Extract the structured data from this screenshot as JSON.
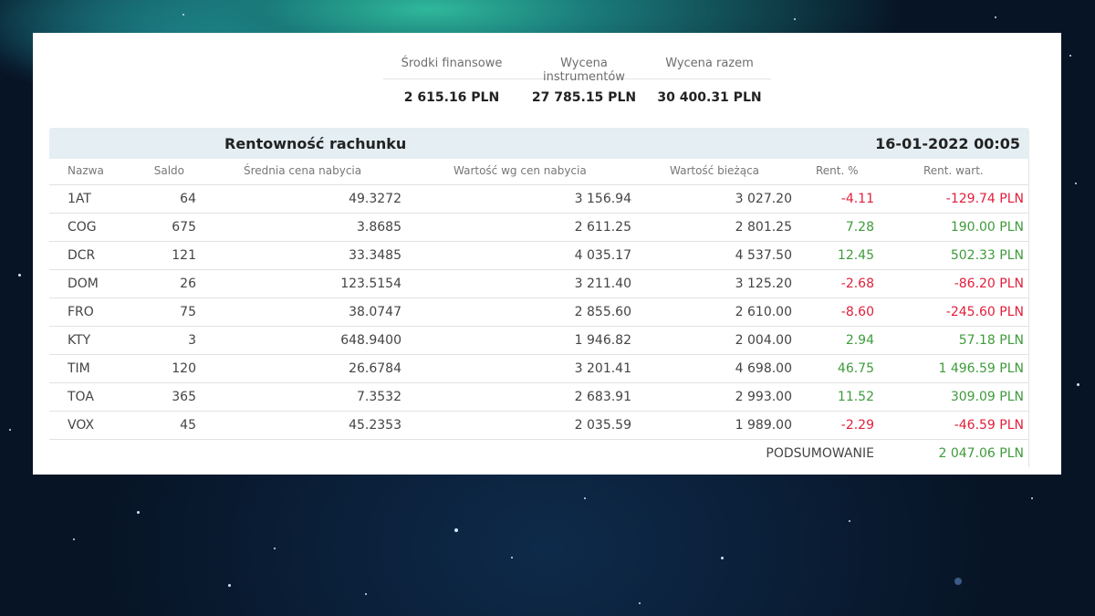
{
  "summary": {
    "labels": [
      "Środki finansowe",
      "Wycena instrumentów",
      "Wycena razem"
    ],
    "values": [
      "2 615.16 PLN",
      "27 785.15 PLN",
      "30 400.31 PLN"
    ]
  },
  "table": {
    "title": "Rentowność rachunku",
    "date": "16-01-2022 00:05",
    "columns": [
      "Nazwa",
      "Saldo",
      "Średnia cena nabycia",
      "Wartość wg cen nabycia",
      "Wartość bieżąca",
      "Rent. %",
      "Rent. wart."
    ],
    "rows": [
      {
        "name": "1AT",
        "saldo": "64",
        "avg": "49.3272",
        "cost": "3 156.94",
        "current": "3 027.20",
        "pct": "-4.11",
        "val": "-129.74 PLN",
        "trend": "neg"
      },
      {
        "name": "COG",
        "saldo": "675",
        "avg": "3.8685",
        "cost": "2 611.25",
        "current": "2 801.25",
        "pct": "7.28",
        "val": "190.00 PLN",
        "trend": "pos"
      },
      {
        "name": "DCR",
        "saldo": "121",
        "avg": "33.3485",
        "cost": "4 035.17",
        "current": "4 537.50",
        "pct": "12.45",
        "val": "502.33 PLN",
        "trend": "pos"
      },
      {
        "name": "DOM",
        "saldo": "26",
        "avg": "123.5154",
        "cost": "3 211.40",
        "current": "3 125.20",
        "pct": "-2.68",
        "val": "-86.20 PLN",
        "trend": "neg"
      },
      {
        "name": "FRO",
        "saldo": "75",
        "avg": "38.0747",
        "cost": "2 855.60",
        "current": "2 610.00",
        "pct": "-8.60",
        "val": "-245.60 PLN",
        "trend": "neg"
      },
      {
        "name": "KTY",
        "saldo": "3",
        "avg": "648.9400",
        "cost": "1 946.82",
        "current": "2 004.00",
        "pct": "2.94",
        "val": "57.18 PLN",
        "trend": "pos"
      },
      {
        "name": "TIM",
        "saldo": "120",
        "avg": "26.6784",
        "cost": "3 201.41",
        "current": "4 698.00",
        "pct": "46.75",
        "val": "1 496.59 PLN",
        "trend": "pos"
      },
      {
        "name": "TOA",
        "saldo": "365",
        "avg": "7.3532",
        "cost": "2 683.91",
        "current": "2 993.00",
        "pct": "11.52",
        "val": "309.09 PLN",
        "trend": "pos"
      },
      {
        "name": "VOX",
        "saldo": "45",
        "avg": "45.2353",
        "cost": "2 035.59",
        "current": "1 989.00",
        "pct": "-2.29",
        "val": "-46.59 PLN",
        "trend": "neg"
      }
    ],
    "footer": {
      "label": "PODSUMOWANIE",
      "value": "2 047.06 PLN"
    }
  },
  "colors": {
    "positive": "#3f9b3c",
    "negative": "#e0203c",
    "header_bg": "#e4eef3"
  }
}
